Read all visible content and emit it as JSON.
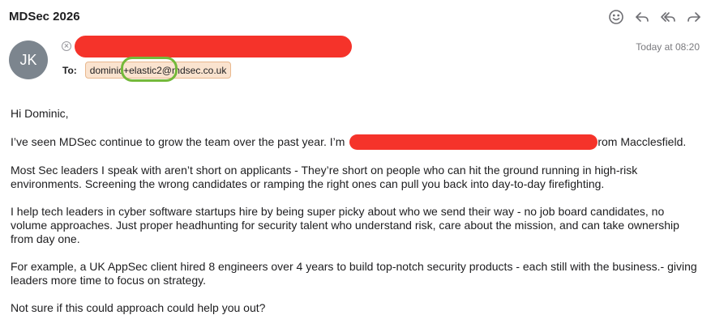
{
  "message": {
    "subject": "MDSec 2026",
    "sender_initials": "JK",
    "date": "Today at 08:20",
    "to_label": "To:",
    "recipient": "dominic+elastic2@mdsec.co.uk"
  },
  "toolbar": {
    "icons": [
      "emoji-icon",
      "reply-icon",
      "reply-all-icon",
      "forward-icon"
    ]
  },
  "body": {
    "greeting": "Hi Dominic,",
    "p1_before": "I’ve seen MDSec continue to grow the team over the past year. I’m ",
    "p1_after": "rom Macclesfield.",
    "p2": "Most Sec leaders I speak with aren’t short on applicants - They’re short on people who can hit the ground running in high-risk environments. Screening the wrong candidates or ramping the right ones can pull you back into day-to-day firefighting.",
    "p3": "I help tech leaders in cyber software startups hire by being super picky about who we send their way - no job board candidates, no volume approaches. Just proper headhunting for security talent who understand risk, care about the mission, and can take ownership from day one.",
    "p4": "For example, a UK AppSec client hired 8 engineers over 4 years to build top-notch security products - each still with the business.- giving leaders more time to focus on strategy.",
    "p5": "Not sure if this could approach could help you out?"
  },
  "colors": {
    "redaction": "#f5332a",
    "highlight": "#74b93a",
    "chip_bg": "#fae3cf",
    "avatar_bg": "#7c858e"
  }
}
